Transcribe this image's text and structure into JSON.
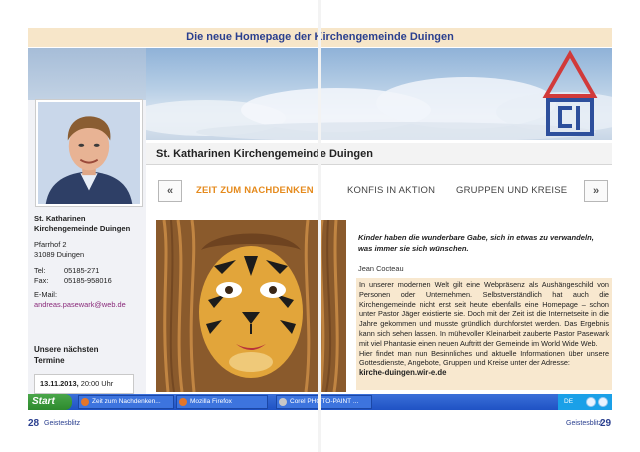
{
  "magazine": {
    "headline": "Die neue Homepage der Kirchengemeinde Duingen",
    "left_page_number": "28",
    "left_page_label": "Geistesblitz",
    "right_page_label": "Geistesblitz",
    "right_page_number": "29"
  },
  "website": {
    "title": "St. Katharinen Kirchengemeinde Duingen",
    "nav": {
      "prev": "«",
      "next": "»",
      "items": [
        "ZEIT ZUM NACHDENKEN",
        "KONFIS IN AKTION",
        "GRUPPEN UND KREISE"
      ],
      "active_index": 0
    },
    "contact": {
      "org_line1": "St. Katharinen",
      "org_line2": "Kirchengemeinde Duingen",
      "street": "Pfarrhof 2",
      "city": "31089 Duingen",
      "tel_label": "Tel:",
      "tel": "05185-271",
      "fax_label": "Fax:",
      "fax": "05185-958016",
      "email_label": "E-Mail:",
      "email": "andreas.pasewark@web.de"
    },
    "events": {
      "heading_line1": "Unsere nächsten",
      "heading_line2": "Termine",
      "first_date": "13.11.2013,",
      "first_time": "20:00 Uhr"
    },
    "quote": {
      "text": "Kinder haben die wunderbare Gabe, sich in etwas zu verwandeln, was immer sie sich wünschen.",
      "author": "Jean Cocteau"
    },
    "article": {
      "lines": [
        "In unserer modernen Welt gilt eine Webpräsenz als Aushängeschild von Personen oder Unternehmen. Selbstverständlich hat auch die Kirchengemeinde nicht erst seit heute ebenfalls eine Homepage – schon unter Pastor Jäger existierte sie. Doch mit der Zeit ist die Internetseite in die Jahre gekommen und musste gründlich durchforstet werden. Das Ergebnis kann sich sehen lassen. In mühevoller Kleinarbeit zauberte Pastor Pasewark mit viel Phantasie einen neuen Auftritt der Gemeinde im World Wide Web.",
        "Hier findet man nun Besinnliches und aktuelle Informationen über unsere Gottesdienste, Angebote, Gruppen und Kreise unter der Adresse:"
      ],
      "site": "kirche-duingen.wir-e.de"
    }
  },
  "taskbar": {
    "start": "Start",
    "tasks": [
      "Zeit zum Nachdenken...",
      "Mozilla Firefox",
      "Corel PHOTO-PAINT ..."
    ],
    "language": "DE"
  },
  "colors": {
    "headline_bg": "#f7e6c9",
    "headline_text": "#2a3f8f",
    "nav_active": "#e58a1c",
    "article_bg": "#f8e8cf",
    "email": "#8a2a7a",
    "logo_red": "#d13a3a",
    "logo_blue": "#2d4f9c"
  },
  "icons": {
    "logo": "church-logo-icon",
    "taskbar_firefox": "firefox-icon",
    "taskbar_corel": "corel-icon"
  }
}
